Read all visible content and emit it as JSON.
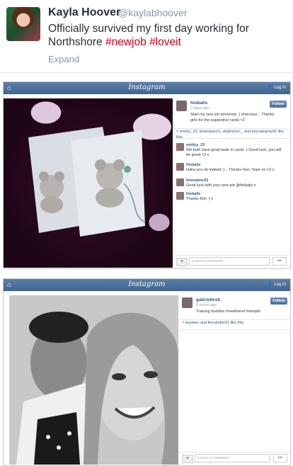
{
  "tweet": {
    "name": "Kayla Hoover",
    "handle": "@kaylabhoover",
    "text": "Officially survived my first day working for Northshore",
    "hashtags": [
      "#newjob",
      "#loveit"
    ],
    "expand": "Expand"
  },
  "posts": [
    {
      "bar": {
        "logo": "Instagram",
        "login": "Log In"
      },
      "user": "hlsbails",
      "ago": "3 days ago",
      "caption": "Start my new job tomorrow :) #nervous... Thanks girls for the supportive cards <3",
      "likes": "emilyy_23, kimelaine23, stephsims_, and beccawardy92 like this.",
      "follow": "Follow",
      "comments": [
        {
          "user": "emilyy_23",
          "text": "We both have good taste in cards :) Good luck, you will be great <3 x"
        },
        {
          "user": "hlsbails",
          "text": "Haha you do indeed :)... Thanks Hun, hope so <3 x"
        },
        {
          "user": "kimelaine23",
          "text": "Good luck with your new job @hlsbails x"
        },
        {
          "user": "hlsbails",
          "text": "Thanks Kim :) x"
        }
      ],
      "input_placeholder": "Leave a comment...",
      "more": "•••"
    },
    {
      "bar": {
        "logo": "Instagram",
        "login": "Log In"
      },
      "user": "gabriellexb",
      "ago": "9 hours ago",
      "caption": "Training buddies #newfriend #newjob",
      "likes": "kaystarr and fernandito31 like this.",
      "follow": "Follow",
      "comments": [],
      "input_placeholder": "Leave a comment...",
      "more": "•••"
    }
  ],
  "colors": {
    "accent": "#3f6591",
    "hashtag": "#d0021b",
    "link": "#2b5a87"
  }
}
